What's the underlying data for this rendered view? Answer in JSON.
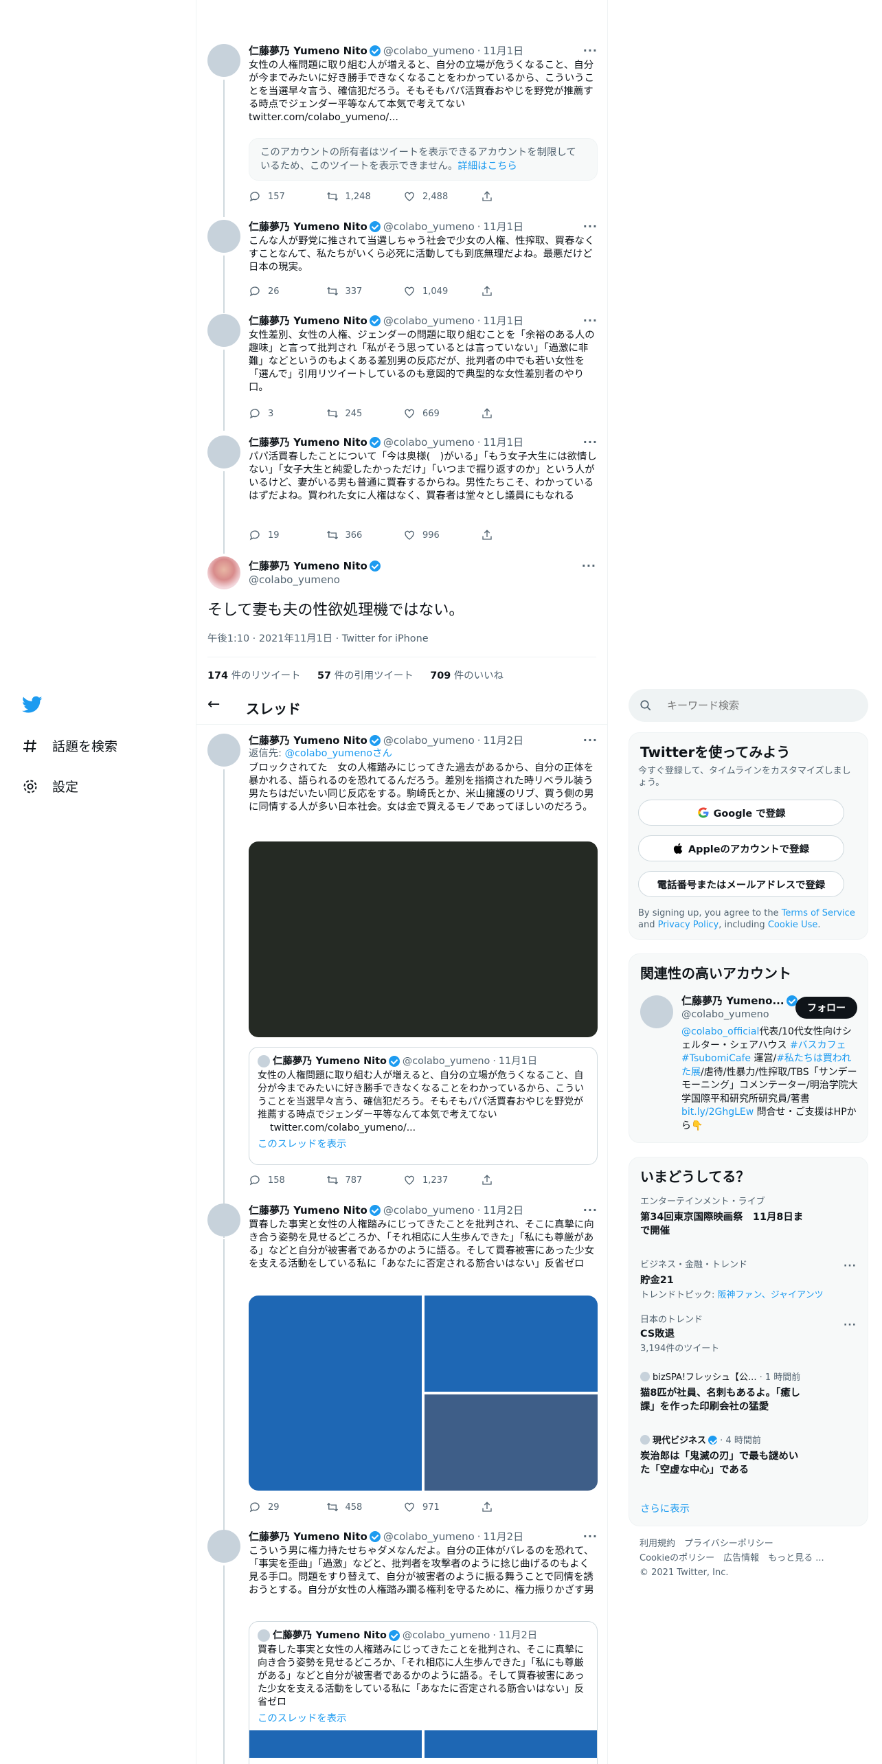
{
  "author": {
    "name": "仁藤夢乃 Yumeno Nito",
    "handle": "@colabo_yumeno",
    "dot": "·"
  },
  "tweets_top": [
    {
      "date": "11月1日",
      "text": "女性の人権問題に取り組む人が増えると、自分の立場が危うくなること、自分が今までみたいに好き勝手できなくなることをわかっているから、こういうことを当選早々言う、確信犯だろう。そもそもパパ活買春おやじを野党が推薦する時点でジェンダー平等なんて本気で考えてない",
      "link": "twitter.com/colabo_yumeno/...",
      "notice": "このアカウントの所有者はツイートを表示できるアカウントを制限しているため、このツイートを表示できません。",
      "notice_link": "詳細はこちら",
      "replies": "157",
      "retweets": "1,248",
      "likes": "2,488"
    },
    {
      "date": "11月1日",
      "text": "こんな人が野党に推されて当選しちゃう社会で少女の人権、性搾取、買春なくすことなんて、私たちがいくら必死に活動しても到底無理だよね。最悪だけど日本の現実。",
      "replies": "26",
      "retweets": "337",
      "likes": "1,049"
    },
    {
      "date": "11月1日",
      "text": "女性差別、女性の人権、ジェンダーの問題に取り組むことを「余裕のある人の趣味」と言って批判され「私がそう思っているとは言っていない」「過激に非難」などというのもよくある差別男の反応だが、批判者の中でも若い女性を「選んで」引用リツイートしているのも意図的で典型的な女性差別者のやり口。",
      "replies": "3",
      "retweets": "245",
      "likes": "669"
    },
    {
      "date": "11月1日",
      "text": "パパ活買春したことについて「今は奥様(　)がいる」「もう女子大生には欲情しない」「女子大生と純愛したかっただけ」「いつまで掘り返すのか」という人がいるけど、妻がいる男も普通に買春するからね。男性たちこそ、わかっているはずだよね。買われた女に人権はなく、買春者は堂々とし議員にもなれる",
      "replies": "19",
      "retweets": "366",
      "likes": "996"
    }
  ],
  "main_tweet": {
    "text": "そして妻も夫の性欲処理機ではない。",
    "meta": "午後1:10 · 2021年11月1日 · Twitter for iPhone",
    "rt_count": "174",
    "rt_label": "件のリツイート",
    "qt_count": "57",
    "qt_label": "件の引用ツイート",
    "like_count": "709",
    "like_label": "件のいいね"
  },
  "thread_header": {
    "back": "←",
    "title": "スレッド"
  },
  "replies": [
    {
      "date": "11月2日",
      "reply_label": "返信先: ",
      "reply_handle": "@colabo_yumenoさん",
      "text": "ブロックされてた　女の人権踏みにじってきた過去があるから、自分の正体を暴かれる、語られるのを恐れてるんだろう。差別を指摘された時リベラル装う男たちはだいたい同じ反応をする。駒崎氏とか、米山擁護のリブ、買う側の男に同情する人が多い日本社会。女は金で買えるモノであってほしいのだろう。",
      "quote": {
        "date": "11月1日",
        "text": "女性の人権問題に取り組む人が増えると、自分の立場が危うくなること、自分が今までみたいに好き勝手できなくなることをわかっているから、こういうことを当選早々言う、確信犯だろう。そもそもパパ活買春おやじを野党が推薦する時点でジェンダー平等なんて本気で考えてない",
        "link": "twitter.com/colabo_yumeno/...",
        "show_thread": "このスレッドを表示"
      },
      "replies": "158",
      "retweets": "787",
      "likes": "1,237"
    },
    {
      "date": "11月2日",
      "text": "買春した事実と女性の人権踏みにじってきたことを批判され、そこに真摯に向き合う姿勢を見せるどころか、「それ相応に人生歩んできた」「私にも尊厳がある」などと自分が被害者であるかのように語る。そして買春被害にあった少女を支える活動をしている私に「あなたに否定される筋合いはない」反省ゼロ",
      "replies": "29",
      "retweets": "458",
      "likes": "971"
    },
    {
      "date": "11月2日",
      "text": "こういう男に権力持たせちゃダメなんだよ。自分の正体がバレるのを恐れて、「事実を歪曲」「過激」などと、批判者を攻撃者のように捻じ曲げるのもよく見る手口。問題をすり替えて、自分が被害者のように振る舞うことで同情を誘おうとする。自分が女性の人権踏み躙る権利を守るために、権力振りかざす男",
      "quote": {
        "date": "11月2日",
        "text": "買春した事実と女性の人権踏みにじってきたことを批判され、そこに真摯に向き合う姿勢を見せるどころか、「それ相応に人生歩んできた」「私にも尊厳がある」などと自分が被害者であるかのように語る。そして買春被害にあった少女を支える活動をしている私に「あなたに否定される筋合いはない」反省ゼロ",
        "show_thread": "このスレッドを表示"
      }
    }
  ],
  "nav": {
    "explore": "話題を検索",
    "settings": "設定"
  },
  "sidebar": {
    "search_placeholder": "キーワード検索",
    "signup": {
      "title": "Twitterを使ってみよう",
      "desc": "今すぐ登録して、タイムラインをカスタマイズしましょう。",
      "google": "Google で登録",
      "apple": "Appleのアカウントで登録",
      "phone": "電話番号またはメールアドレスで登録",
      "terms_prefix": "By signing up, you agree to the ",
      "terms": "Terms of Service",
      "and": " and ",
      "privacy": "Privacy Policy",
      "incl": ", including ",
      "cookie": "Cookie Use",
      "end": "."
    },
    "relevant": {
      "title": "関連性の高いアカウント",
      "name": "仁藤夢乃 Yumeno...",
      "handle": "@colabo_yumeno",
      "follow": "フォロー",
      "bio_1": "@colabo_official",
      "bio_2": "代表/10代女性向けシェルター・シェアハウス ",
      "bio_3": "#バスカフェ",
      "bio_4": " ",
      "bio_5": "#TsubomiCafe",
      "bio_6": " 運営/",
      "bio_7": "#私たちは買われた展",
      "bio_8": "/虐待/性暴力/性搾取/TBS「サンデーモーニング」コメンテーター/明治学院大学国際平和研究所研究員/著書",
      "bio_9": "bit.ly/2GhgLEw",
      "bio_10": " 問合せ・ご支援はHPから👇"
    },
    "trends": {
      "title": "いまどうしてる？",
      "items": [
        {
          "cat": "エンターテインメント・ライブ",
          "title": "第34回東京国際映画祭　11月8日まで開催"
        },
        {
          "cat": "ビジネス・金融・トレンド",
          "title": "貯金21",
          "sub_prefix": "トレンドトピック: ",
          "sub_link": "阪神ファン、ジャイアンツ"
        },
        {
          "cat": "日本のトレンド",
          "title": "CS敗退",
          "sub": "3,194件のツイート"
        },
        {
          "source": "bizSPA!フレッシュ【公...",
          "time": "· 1 時間前",
          "title": "猫8匹が社員、名刺もあるよ。「癒し課」を作った印刷会社の猛愛"
        },
        {
          "source": "現代ビジネス",
          "time": "· 4 時間前",
          "title": "炭治郎は「鬼滅の刃」で最も謎めいた「空虚な中心」である"
        }
      ],
      "show_more": "さらに表示"
    },
    "footer": {
      "line1": "利用規約　プライバシーポリシー",
      "line2": "Cookieのポリシー　広告情報　もっと見る ...",
      "line3": "© 2021 Twitter, Inc."
    }
  },
  "colors": {
    "accent": "#1d9bf0",
    "border": "#eff3f4",
    "muted": "#536471"
  }
}
